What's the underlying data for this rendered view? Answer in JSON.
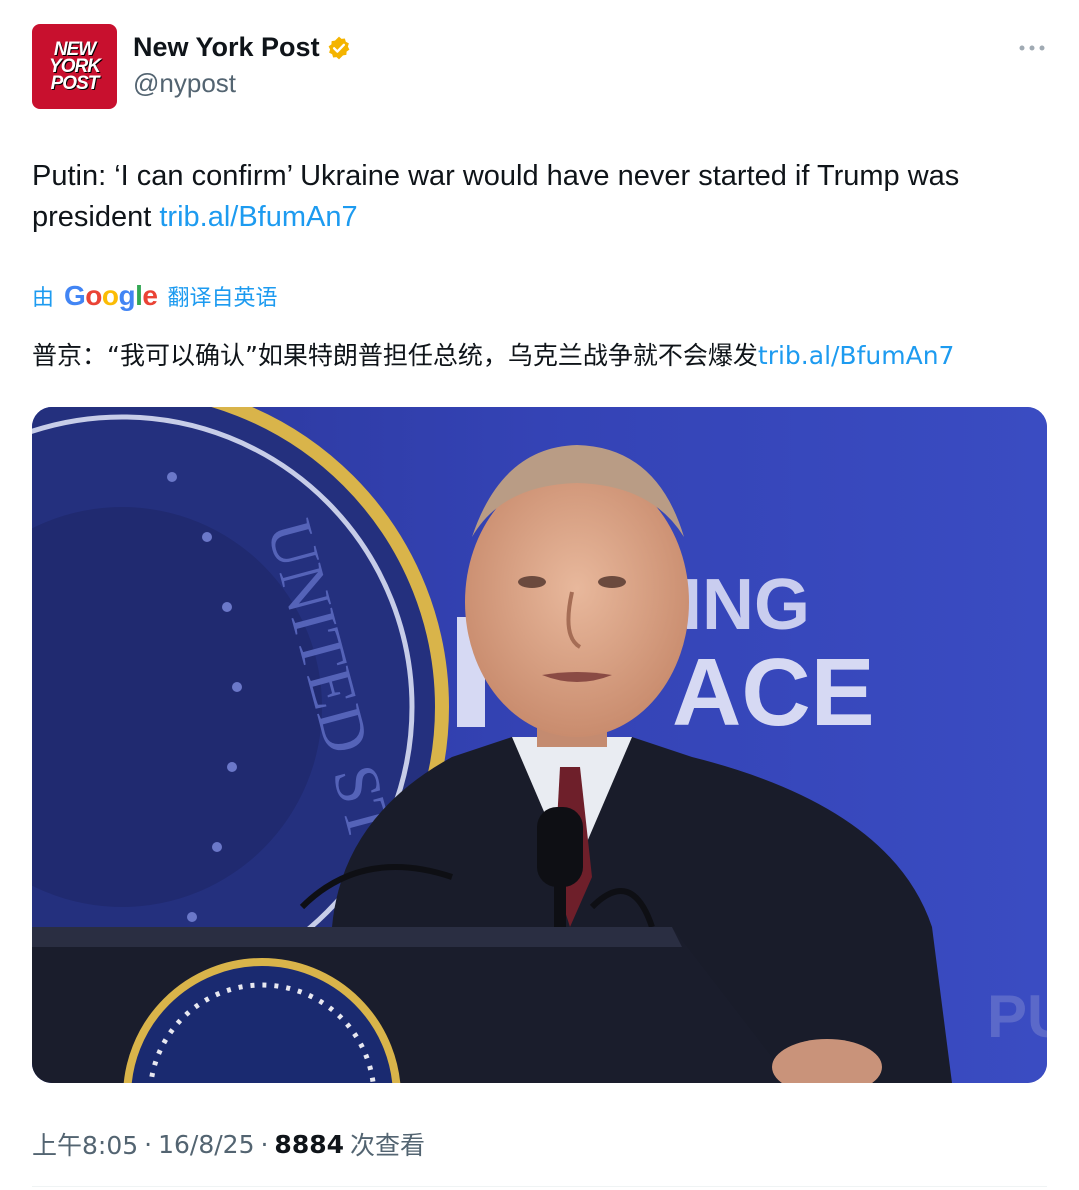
{
  "author": {
    "logo_lines": [
      "NEW",
      "YORK",
      "POST"
    ],
    "display_name": "New York Post",
    "handle": "@nypost",
    "verified_icon": "gold-verified-badge",
    "verified_color": "#f4b400"
  },
  "tweet": {
    "text": "Putin: ‘I can confirm’ Ukraine war would have never started if Trump was president ",
    "link": "trib.al/BfumAn7"
  },
  "translation": {
    "prefix": "由",
    "provider": "Google",
    "label": "翻译自英语",
    "text": "普京：“我可以确认”如果特朗普担任总统，乌克兰战争就不会爆发",
    "link": "trib.al/BfumAn7"
  },
  "media": {
    "backdrop_words": [
      "ING",
      "ACE",
      "PU"
    ],
    "seal_letters": "UNITED ST"
  },
  "meta": {
    "time": "上午8:05",
    "date": "16/8/25",
    "views_count": "8884",
    "views_label": "次查看"
  },
  "colors": {
    "link": "#1d9bf0",
    "brand_red": "#c8102e",
    "secondary_text": "#536471"
  }
}
